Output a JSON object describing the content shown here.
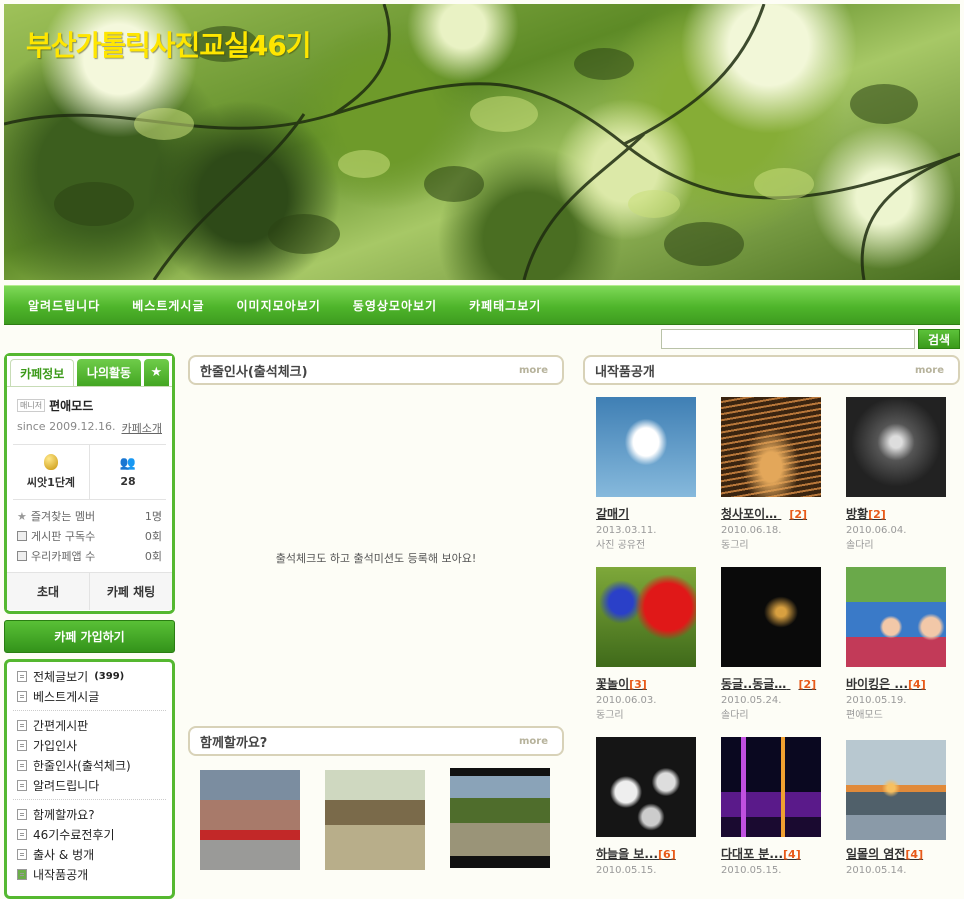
{
  "banner": {
    "title": "부산가톨릭사진교실46기"
  },
  "nav": [
    "알려드립니다",
    "베스트게시글",
    "이미지모아보기",
    "동영상모아보기",
    "카페태그보기"
  ],
  "search": {
    "button": "검색",
    "placeholder": ""
  },
  "cafe_info": {
    "tabs": [
      "카페정보",
      "나의활동"
    ],
    "manager_tag": "매니저",
    "manager_name": "편애모드",
    "since": "since 2009.12.16.",
    "intro_link": "카페소개",
    "level": "씨앗1단계",
    "members": "28",
    "rows": [
      {
        "label": "즐겨찾는 멤버",
        "value": "1명"
      },
      {
        "label": "게시판 구독수",
        "value": "0회"
      },
      {
        "label": "우리카페앱 수",
        "value": "0회"
      }
    ],
    "invite": "초대",
    "chat": "카페 채팅"
  },
  "join_button": "카페 가입하기",
  "menu": {
    "group1": [
      "전체글보기",
      "베스트게시글"
    ],
    "total_count": "(399)",
    "group2": [
      "간편게시판",
      "가입인사",
      "한줄인사(출석체크)",
      "알려드립니다"
    ],
    "group3": [
      "함께할까요?",
      "46기수료전후기",
      "출사 & 벙개",
      "내작품공개"
    ]
  },
  "greeting_panel": {
    "title": "한줄인사(출석체크)",
    "more": "more",
    "message": "출석체크도 하고 출석미션도 등록해 보아요!"
  },
  "together_panel": {
    "title": "함께할까요?",
    "more": "more"
  },
  "works_panel": {
    "title": "내작품공개",
    "more": "more",
    "items": [
      {
        "title": "갈매기",
        "count": "",
        "date": "2013.03.11.",
        "author": "사진 공유전"
      },
      {
        "title": "청사포이…",
        "count": "[2]",
        "date": "2010.06.18.",
        "author": "동그리"
      },
      {
        "title": "방황",
        "count": "[2]",
        "date": "2010.06.04.",
        "author": "솔다리"
      },
      {
        "title": "꽃놀이",
        "count": "[3]",
        "date": "2010.06.03.",
        "author": "동그리"
      },
      {
        "title": "동글..동글…",
        "count": "[2]",
        "date": "2010.05.24.",
        "author": "솔다리"
      },
      {
        "title": "바이킹은 ...",
        "count": "[4]",
        "date": "2010.05.19.",
        "author": "편애모드"
      },
      {
        "title": "하늘을 보...",
        "count": "[6]",
        "date": "2010.05.15.",
        "author": ""
      },
      {
        "title": "다대포 분...",
        "count": "[4]",
        "date": "2010.05.15.",
        "author": ""
      },
      {
        "title": "일몰의 염전",
        "count": "[4]",
        "date": "2010.05.14.",
        "author": ""
      }
    ]
  },
  "colors": {
    "nav_green": "#4fb52b",
    "banner_title": "#ffe600",
    "count_orange": "#e85a1a"
  }
}
